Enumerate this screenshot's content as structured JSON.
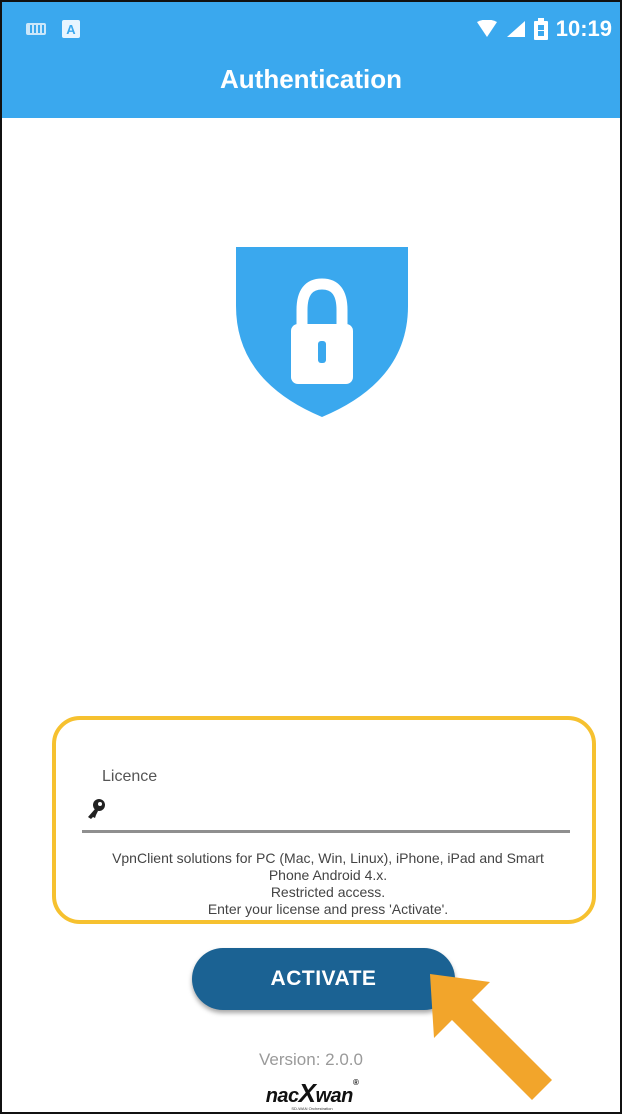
{
  "status_bar": {
    "time": "10:19",
    "left_icons": [
      "keyboard-icon",
      "a-app-icon"
    ],
    "right_icons": [
      "wifi-icon",
      "signal-icon",
      "battery-icon"
    ]
  },
  "app_bar": {
    "title": "Authentication",
    "color": "#3aa8ee"
  },
  "hero": {
    "icon": "shield-lock-icon",
    "color": "#3aa8ee"
  },
  "license_card": {
    "field_label": "Licence",
    "field_value": "",
    "field_icon": "key-icon",
    "info_lines": [
      "VpnClient solutions for PC (Mac, Win, Linux), iPhone, iPad and Smart",
      "Phone Android 4.x.",
      "Restricted access.",
      "Enter your license and press 'Activate'."
    ],
    "highlight_color": "#f6c12f"
  },
  "activate_button": {
    "label": "ACTIVATE",
    "color": "#1b6293"
  },
  "footer": {
    "version": "Version: 2.0.0",
    "logo_text": "nacXwan",
    "logo_subtitle": "SD-WAN Orchestration"
  },
  "annotation": {
    "icon": "arrow-icon",
    "color": "#f2a52b"
  }
}
